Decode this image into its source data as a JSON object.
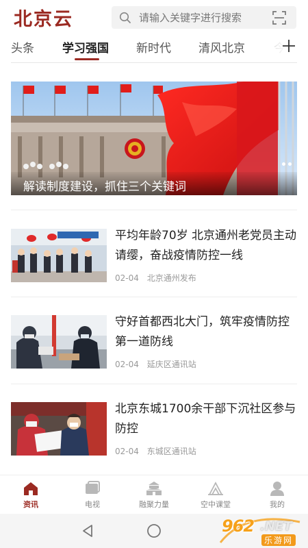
{
  "header": {
    "logo": "北京云",
    "search_placeholder": "请输入关键字进行搜索"
  },
  "tabs": [
    {
      "label": "头条",
      "active": false
    },
    {
      "label": "学习强国",
      "active": true
    },
    {
      "label": "新时代",
      "active": false
    },
    {
      "label": "清风北京",
      "active": false
    },
    {
      "label": "今",
      "active": false
    }
  ],
  "banner": {
    "caption": "解读制度建设，抓住三个关键词"
  },
  "news": [
    {
      "title": "平均年龄70岁 北京通州老党员主动请缨，奋战疫情防控一线",
      "date": "02-04",
      "source": "北京通州发布"
    },
    {
      "title": "守好首都西北大门，筑牢疫情防控第一道防线",
      "date": "02-04",
      "source": "延庆区通讯站"
    },
    {
      "title": "北京东城1700余干部下沉社区参与防控",
      "date": "02-04",
      "source": "东城区通讯站"
    }
  ],
  "bottom_nav": [
    {
      "label": "资讯",
      "icon": "home-icon",
      "active": true
    },
    {
      "label": "电视",
      "icon": "tv-icon",
      "active": false
    },
    {
      "label": "融聚力量",
      "icon": "tiananmen-icon",
      "active": false
    },
    {
      "label": "空中课堂",
      "icon": "classroom-icon",
      "active": false
    },
    {
      "label": "我的",
      "icon": "user-icon",
      "active": false
    }
  ],
  "watermark": {
    "number": "962",
    "net": ".NET",
    "cn": "乐游网"
  },
  "colors": {
    "accent": "#9b2a22",
    "active_text": "#222222",
    "muted_text": "#999999"
  }
}
